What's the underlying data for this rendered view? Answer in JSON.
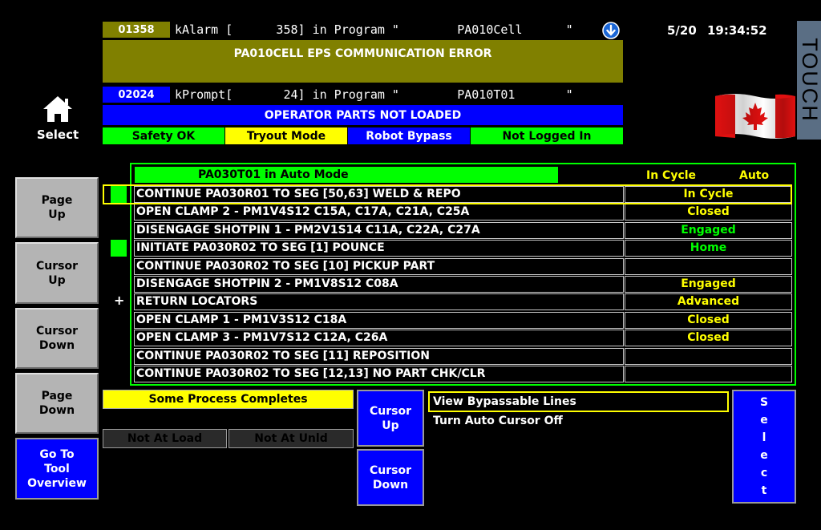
{
  "alarm": {
    "number": "01358",
    "line": "kAlarm [      358] in Program \"        PA010Cell      \"",
    "banner": "PA010CELL EPS COMMUNICATION ERROR",
    "info_icon": "down-arrow-circle-icon"
  },
  "prompt": {
    "number": "02024",
    "line": "kPrompt[       24] in Program \"        PA010T01       \"",
    "banner": "OPERATOR PARTS NOT LOADED"
  },
  "status_bar": [
    "Safety OK",
    "Tryout Mode",
    "Robot Bypass",
    "Not Logged In"
  ],
  "datetime": {
    "date": "5/20",
    "time": "19:34:52"
  },
  "touch_label": "TOUCH",
  "home": {
    "icon": "home-icon",
    "label": "Select"
  },
  "flag": {
    "icon": "canada-flag-icon"
  },
  "sidebar": {
    "page_up": "Page\nUp",
    "cursor_up": "Cursor\nUp",
    "cursor_down": "Cursor\nDown",
    "page_down": "Page\nDown",
    "go_to_tool": "Go To\nTool\nOverview"
  },
  "sequence": {
    "title": "PA030T01 in Auto Mode",
    "cycle_status": "In Cycle",
    "mode": "Auto",
    "rows": [
      {
        "step": "CONTINUE PA030R01 TO SEG [50,63] WELD & REPO",
        "status": "In Cycle",
        "status_color": "#ffff00",
        "indicator": true,
        "selected": true
      },
      {
        "step": "OPEN CLAMP 2 - PM1V4S12 C15A, C17A, C21A, C25A",
        "status": "Closed",
        "status_color": "#ffff00",
        "indicator": false
      },
      {
        "step": "DISENGAGE SHOTPIN 1 - PM2V1S14 C11A, C22A, C27A",
        "status": "Engaged",
        "status_color": "#00ff00",
        "indicator": false
      },
      {
        "step": "INITIATE PA030R02 TO SEG [1] POUNCE",
        "status": "Home",
        "status_color": "#00ff00",
        "indicator": true
      },
      {
        "step": "CONTINUE PA030R02 TO SEG [10] PICKUP PART",
        "status": "",
        "status_color": "#ffff00",
        "indicator": false
      },
      {
        "step": "DISENGAGE SHOTPIN 2 - PM1V8S12 C08A",
        "status": "Engaged",
        "status_color": "#ffff00",
        "indicator": false
      },
      {
        "step": "RETURN LOCATORS",
        "status": "Advanced",
        "status_color": "#ffff00",
        "indicator": false,
        "plus": "+"
      },
      {
        "step": "OPEN CLAMP 1 - PM1V3S12 C18A",
        "status": "Closed",
        "status_color": "#ffff00",
        "indicator": false
      },
      {
        "step": "OPEN CLAMP 3 - PM1V7S12 C12A, C26A",
        "status": "Closed",
        "status_color": "#ffff00",
        "indicator": false
      },
      {
        "step": "CONTINUE PA030R02 TO SEG [11] REPOSITION",
        "status": "",
        "status_color": "#ffff00",
        "indicator": false
      },
      {
        "step": "CONTINUE PA030R02 TO SEG [12,13] NO PART CHK/CLR",
        "status": "",
        "status_color": "#ffff00",
        "indicator": false
      }
    ]
  },
  "bottom": {
    "process": "Some Process Completes",
    "not_at_load": "Not At Load",
    "not_at_unld": "Not At Unld",
    "cursor_up": "Cursor\nUp",
    "cursor_down": "Cursor\nDown",
    "options": [
      "View Bypassable Lines",
      "Turn Auto Cursor Off"
    ],
    "select": "S\ne\nl\ne\nc\nt"
  },
  "colors": {
    "olive": "#808000",
    "blue": "#0000ff",
    "green": "#00ff00",
    "yellow": "#ffff00",
    "gray_button": "#b4b4b4"
  }
}
